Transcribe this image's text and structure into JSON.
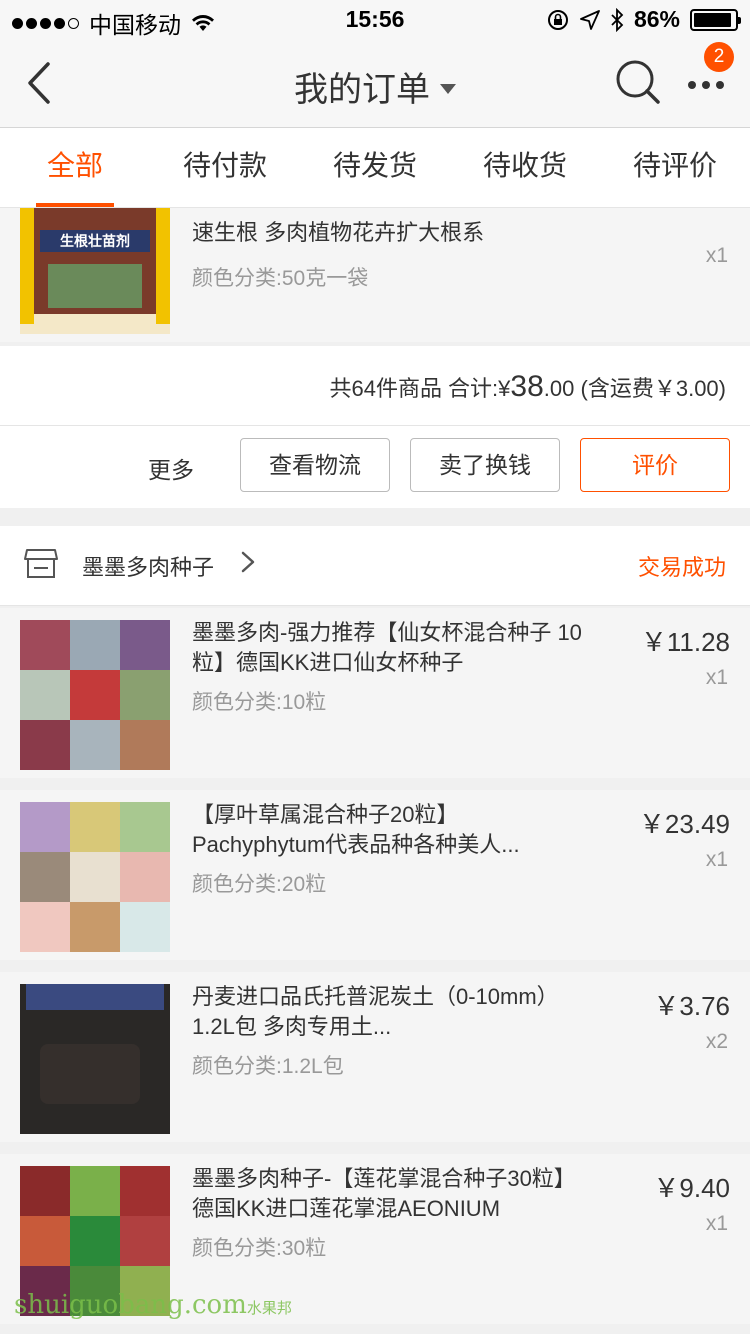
{
  "status_bar": {
    "carrier": "中国移动",
    "time": "15:56",
    "battery": "86%"
  },
  "nav": {
    "title": "我的订单",
    "badge_count": "2"
  },
  "tabs": [
    "全部",
    "待付款",
    "待发货",
    "待收货",
    "待评价"
  ],
  "order1": {
    "item": {
      "title": "速生根 多肉植物花卉扩大根系",
      "spec": "颜色分类:50克一袋",
      "qty": "x1",
      "thumb_text": "生根壮苗剂"
    },
    "summary": {
      "count_label": "共64件商品 合计:",
      "currency": "¥",
      "total_int": "38",
      "total_dec": ".00",
      "shipping": "(含运费￥3.00)"
    },
    "actions": {
      "more": "更多",
      "logistics": "查看物流",
      "sell": "卖了换钱",
      "review": "评价"
    }
  },
  "order2": {
    "shop_name": "墨墨多肉种子",
    "status": "交易成功",
    "items": [
      {
        "title": "墨墨多肉-强力推荐【仙女杯混合种子 10粒】德国KK进口仙女杯种子",
        "spec": "颜色分类:10粒",
        "price": "￥11.28",
        "qty": "x1"
      },
      {
        "title": "【厚叶草属混合种子20粒】Pachyphytum代表品种各种美人...",
        "spec": "颜色分类:20粒",
        "price": "￥23.49",
        "qty": "x1"
      },
      {
        "title": "丹麦进口品氏托普泥炭土（0-10mm）1.2L包 多肉专用土...",
        "spec": "颜色分类:1.2L包",
        "price": "￥3.76",
        "qty": "x2"
      },
      {
        "title": "墨墨多肉种子-【莲花掌混合种子30粒】德国KK进口莲花掌混AEONIUM",
        "spec": "颜色分类:30粒",
        "price": "￥9.40",
        "qty": "x1"
      }
    ]
  },
  "watermark": {
    "main": "shuiguobang.com",
    "cn": "水果邦"
  },
  "colors": {
    "accent": "#ff5000",
    "bg": "#f0f0f0"
  }
}
